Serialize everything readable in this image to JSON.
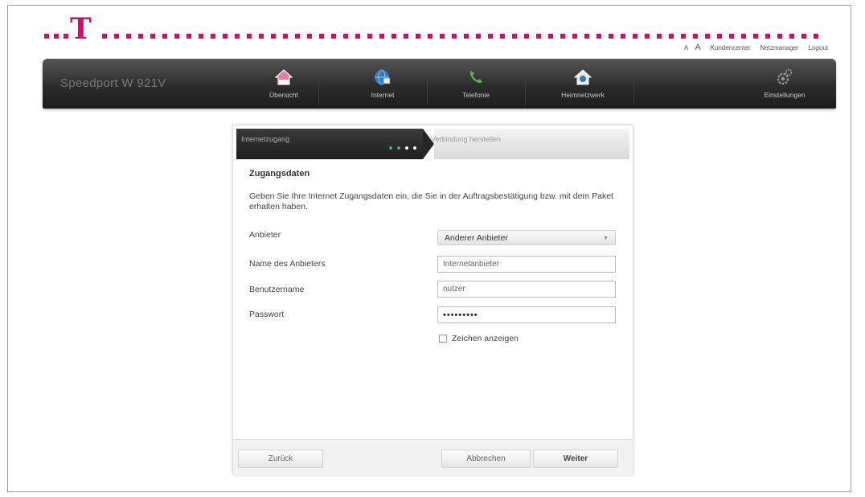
{
  "brand": {
    "logo_letter": "T",
    "accent_color": "#e20074",
    "name": "Speedport W 921V"
  },
  "toplinks": {
    "font_small": "A",
    "font_large": "A",
    "customer_center": "Kundencenter",
    "network_manager": "Netzmanager",
    "logout": "Logout"
  },
  "nav": {
    "items": [
      {
        "label": "Übersicht",
        "icon": "home-icon"
      },
      {
        "label": "Internet",
        "icon": "globe-icon"
      },
      {
        "label": "Telefonie",
        "icon": "phone-icon"
      },
      {
        "label": "Heimnetzwerk",
        "icon": "home-network-icon"
      }
    ],
    "settings": {
      "label": "Einstellungen",
      "icon": "gear-icon"
    }
  },
  "wizard": {
    "steps": [
      {
        "label": "Internetzugang",
        "active": true
      },
      {
        "label": "Verbindung herstellen",
        "active": false
      }
    ],
    "progress_dots": [
      "#4caf50",
      "#4caf50",
      "#ffffff",
      "#ffffff"
    ],
    "heading": "Zugangsdaten",
    "intro": "Geben Sie Ihre Internet Zugangsdaten ein, die Sie in der Auftragsbestätigung bzw. mit dem Paket erhalten haben.",
    "fields": {
      "provider": {
        "label": "Anbieter",
        "value": "Anderer Anbieter"
      },
      "provider_name": {
        "label": "Name des Anbieters",
        "value": "Internetanbieter"
      },
      "username": {
        "label": "Benutzername",
        "value": "nutzer"
      },
      "password": {
        "label": "Passwort",
        "value": "•••••••••"
      }
    },
    "show_chars_label": "Zeichen anzeigen",
    "show_chars_checked": false,
    "buttons": {
      "back": "Zurück",
      "cancel": "Abbrechen",
      "next": "Weiter"
    }
  }
}
